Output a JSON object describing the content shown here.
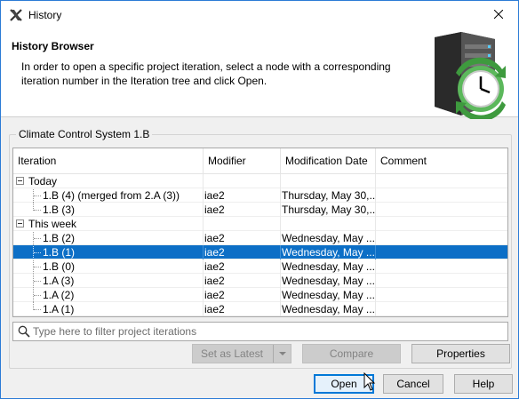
{
  "window": {
    "title": "History"
  },
  "header": {
    "title": "History Browser",
    "description": "In order to open a specific project iteration, select a node with a corresponding iteration number in the Iteration tree and click Open."
  },
  "group": {
    "label": "Climate Control System 1.B"
  },
  "table": {
    "columns": [
      "Iteration",
      "Modifier",
      "Modification Date",
      "Comment"
    ],
    "groups": [
      {
        "label": "Today",
        "rows": [
          {
            "iteration": "1.B (4) (merged from 2.A (3))",
            "modifier": "iae2",
            "date": "Thursday, May 30,...",
            "comment": ""
          },
          {
            "iteration": "1.B (3)",
            "modifier": "iae2",
            "date": "Thursday, May 30,...",
            "comment": ""
          }
        ]
      },
      {
        "label": "This week",
        "rows": [
          {
            "iteration": "1.B (2)",
            "modifier": "iae2",
            "date": "Wednesday, May ...",
            "comment": ""
          },
          {
            "iteration": "1.B (1)",
            "modifier": "iae2",
            "date": "Wednesday, May ...",
            "comment": "",
            "selected": true
          },
          {
            "iteration": "1.B (0)",
            "modifier": "iae2",
            "date": "Wednesday, May ...",
            "comment": ""
          },
          {
            "iteration": "1.A (3)",
            "modifier": "iae2",
            "date": "Wednesday, May ...",
            "comment": ""
          },
          {
            "iteration": "1.A (2)",
            "modifier": "iae2",
            "date": "Wednesday, May ...",
            "comment": ""
          },
          {
            "iteration": "1.A (1)",
            "modifier": "iae2",
            "date": "Wednesday, May ...",
            "comment": ""
          }
        ]
      }
    ]
  },
  "filter": {
    "placeholder": "Type here to filter project iterations",
    "value": ""
  },
  "actions": {
    "set_as_latest": "Set as Latest",
    "compare": "Compare",
    "properties": "Properties"
  },
  "footer": {
    "open": "Open",
    "cancel": "Cancel",
    "help": "Help"
  },
  "colors": {
    "accent": "#0078d7",
    "selection": "#0c6fc6",
    "window_border": "#2b7bd6"
  },
  "icons": {
    "app": "magicdraw-x-icon",
    "close": "close-icon",
    "search": "search-icon",
    "dropdown": "chevron-down-icon",
    "banner": "server-clock-icon"
  }
}
